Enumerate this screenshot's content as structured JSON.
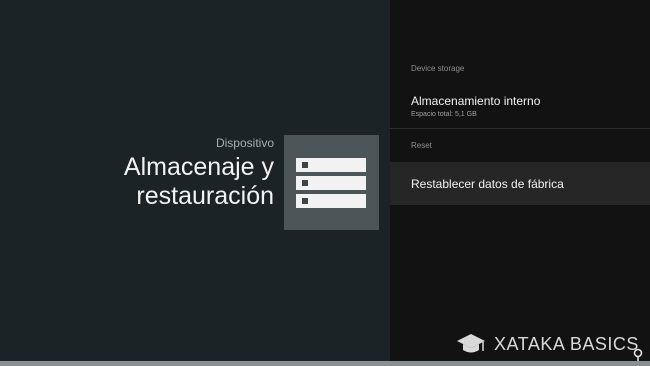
{
  "header": {
    "category": "Dispositivo",
    "title": "Almacenaje y restauración"
  },
  "tile": {
    "icon": "storage-icon"
  },
  "sections": [
    {
      "header": "Device storage",
      "items": [
        {
          "title": "Almacenamiento interno",
          "subtitle": "Espacio total: 5,1 GB"
        }
      ]
    },
    {
      "header": "Reset",
      "items": [
        {
          "title": "Restablecer datos de fábrica",
          "selected": true
        }
      ]
    }
  ],
  "watermark": {
    "text": "XATAKA BASICS",
    "icon": "graduation-cap-icon"
  },
  "colors": {
    "left_background": "#1c2327",
    "right_background": "#121212",
    "selected_row": "#262626",
    "tile": "#4c5557"
  }
}
